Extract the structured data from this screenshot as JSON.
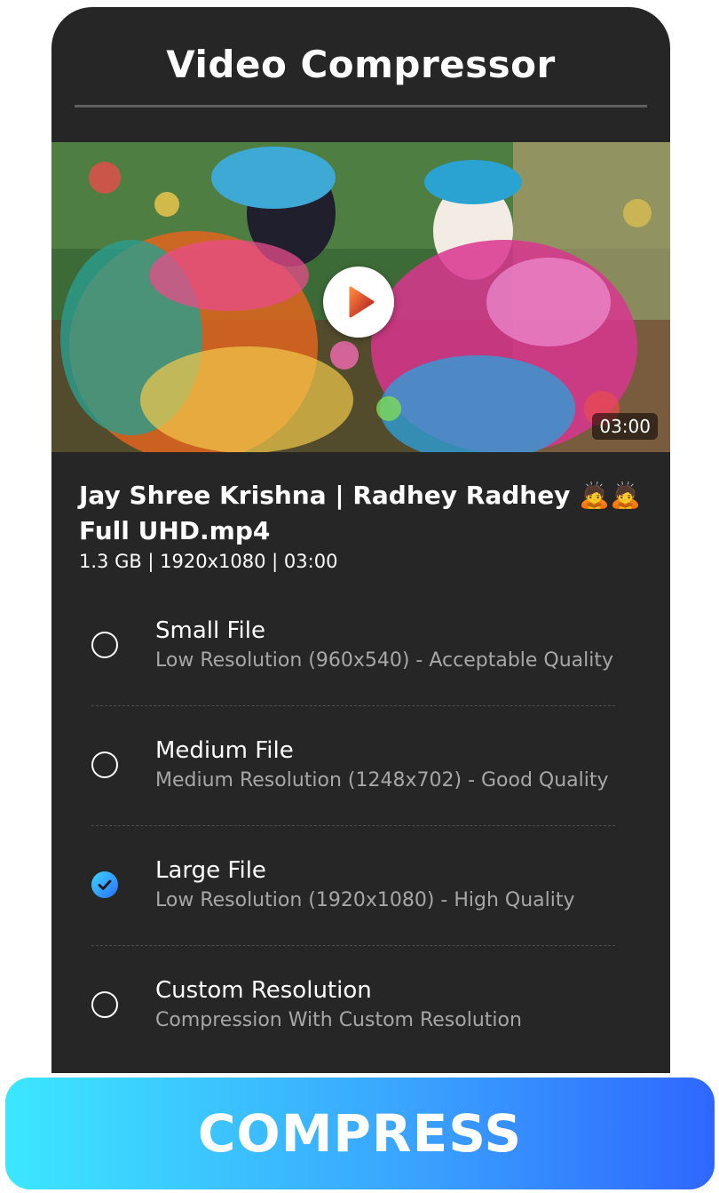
{
  "header": {
    "title": "Video Compressor"
  },
  "video": {
    "thumbnail_icon": "play-icon",
    "duration": "03:00",
    "file_name": "Jay Shree Krishna | Radhey Radhey 🙇🙇 Full UHD.mp4",
    "meta": "1.3 GB | 1920x1080 | 03:00"
  },
  "options": [
    {
      "title": "Small File",
      "subtitle": "Low Resolution (960x540) - Acceptable Quality",
      "selected": false
    },
    {
      "title": "Medium File",
      "subtitle": "Medium Resolution (1248x702) - Good Quality",
      "selected": false
    },
    {
      "title": "Large File",
      "subtitle": "Low Resolution (1920x1080) - High Quality",
      "selected": true
    },
    {
      "title": "Custom Resolution",
      "subtitle": "Compression With Custom Resolution",
      "selected": false
    }
  ],
  "actions": {
    "compress_label": "COMPRESS"
  },
  "colors": {
    "panel_bg": "#262626",
    "accent_start": "#3ce7ff",
    "accent_end": "#2f67ff",
    "subtitle_text": "#a7a7a7"
  }
}
